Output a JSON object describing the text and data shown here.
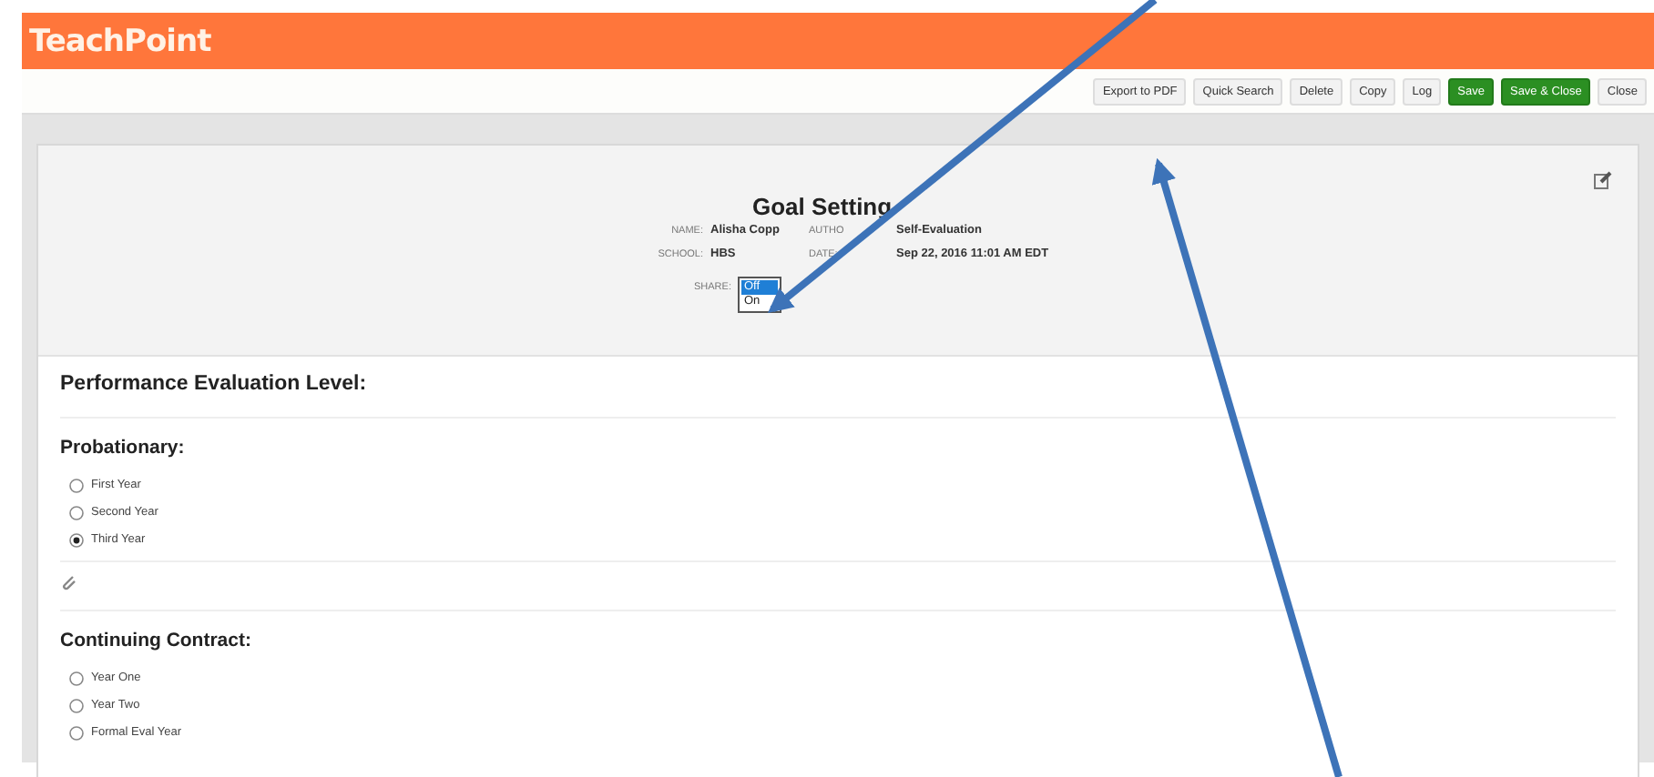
{
  "app": {
    "logo": "TeachPoint"
  },
  "toolbar": [
    {
      "label": "Export to PDF",
      "kind": "plain"
    },
    {
      "label": "Quick Search",
      "kind": "plain"
    },
    {
      "label": "Delete",
      "kind": "plain"
    },
    {
      "label": "Copy",
      "kind": "plain"
    },
    {
      "label": "Log",
      "kind": "plain"
    },
    {
      "label": "Save",
      "kind": "primary"
    },
    {
      "label": "Save & Close",
      "kind": "primary"
    },
    {
      "label": "Close",
      "kind": "plain"
    }
  ],
  "form": {
    "title": "Goal Setting",
    "name_label": "NAME:",
    "name": "Alisha Copp",
    "author_label": "AUTHO",
    "author": "Self-Evaluation",
    "school_label": "SCHOOL:",
    "school": "HBS",
    "date_label": "DATE:",
    "date": "Sep 22, 2016 11:01 AM EDT",
    "share_label": "SHARE:",
    "share_options": [
      {
        "label": "Off",
        "selected": true
      },
      {
        "label": "On",
        "selected": false
      }
    ]
  },
  "section_title": "Performance Evaluation Level:",
  "groups": [
    {
      "title": "Probationary:",
      "attachment": true,
      "options": [
        {
          "label": "First Year",
          "selected": false
        },
        {
          "label": "Second Year",
          "selected": false
        },
        {
          "label": "Third Year",
          "selected": true
        }
      ]
    },
    {
      "title": "Continuing Contract:",
      "attachment": false,
      "options": [
        {
          "label": "Year One",
          "selected": false
        },
        {
          "label": "Year Two",
          "selected": false
        },
        {
          "label": "Formal Eval Year",
          "selected": false
        }
      ]
    }
  ]
}
